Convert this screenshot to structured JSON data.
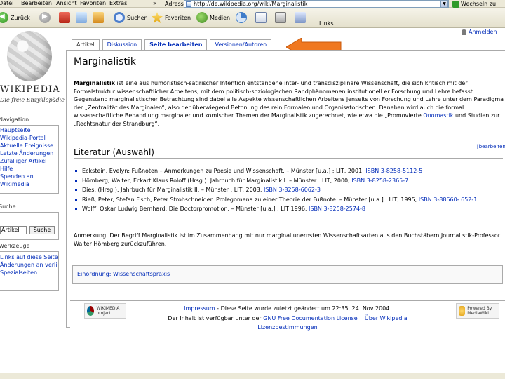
{
  "browser": {
    "menu": [
      "Datei",
      "Bearbeiten",
      "Ansicht",
      "Favoriten",
      "Extras"
    ],
    "menu_more": "»",
    "toolbar": {
      "back": "Zurück",
      "search": "Suchen",
      "favorites": "Favoriten",
      "media": "Medien"
    },
    "address_label": "Adresse",
    "address_url": "http://de.wikipedia.org/wiki/Marginalistik",
    "go_label": "Wechseln zu",
    "links_label": "Links"
  },
  "logo": {
    "wordmark": "WIKIPEDIA",
    "motto": "Die freie Enzyklopädie"
  },
  "sidebar": {
    "nav_heading": "Navigation",
    "nav_items": [
      "Hauptseite",
      "Wikipedia-Portal",
      "Aktuelle Ereignisse",
      "Letzte Änderungen",
      "Zufälliger Artikel",
      "Hilfe",
      "Spenden an",
      "Wikimedia"
    ],
    "search_heading": "Suche",
    "search_go": "Artikel",
    "search_button": "Suche",
    "tools_heading": "Werkzeuge",
    "tools_items": [
      "Links auf diese Seite",
      "Änderungen an verlinkten Seiten",
      "Spezialseiten"
    ]
  },
  "user": {
    "login": "Anmelden"
  },
  "tabs": [
    {
      "label": "Artikel"
    },
    {
      "label": "Diskussion"
    },
    {
      "label": "Seite bearbeiten"
    },
    {
      "label": "Versionen/Autoren"
    }
  ],
  "article": {
    "title": "Marginalistik",
    "intro_term": "Marginalistik",
    "intro_text": " ist eine aus humoristisch-satirischer Intention entstandene inter- und transdisziplinäre Wissenschaft, die sich kritisch mit der Formalstruktur wissenschaftlicher Arbeitens, mit dem politisch-soziologischen Randphänomenen institutionell er Forschung und Lehre befasst. Gegenstand marginalistischer Betrachtung sind dabei alle Aspekte wissenschaftlichen Arbeitens jenseits von Forschung und Lehre unter dem Paradigma der „Zentralität des Marginalen“, also der überwiegend Betonung des rein Formalen und Organisatorischen. Daneben wird auch die formal wissenschaftliche Behandlung marginaler und komischer Themen der Marginalistik zugerechnet, wie etwa die ",
    "intro_link": "Onomastik",
    "intro_tail": " und Studien zur „Rechtsnatur der Strandburg“.",
    "intro_lead": "„Promovierte ",
    "lit_heading": "Literatur (Auswahl)",
    "lit_edit": "[bearbeiten]",
    "literature": [
      {
        "text": "Eckstein, Evelyn: Fußnoten – Anmerkungen zu Poesie und Wissenschaft. – Münster [u.a.] : LIT, 2001.",
        "isbn": "ISBN 3-8258-5112-5"
      },
      {
        "text": "Hömberg, Walter, Eckart Klaus Roloff (Hrsg.): Jahrbuch für Marginalistik I. – Münster : LIT, 2000,",
        "isbn": "ISBN 3-8258-2365-7"
      },
      {
        "text": "Dies. (Hrsg.): Jahrbuch für Marginalistik II. – Münster : LIT, 2003,",
        "isbn": "ISBN 3-8258-6062-3"
      },
      {
        "text": "Rieß, Peter, Stefan Fisch, Peter Strohschneider: Prolegomena zu einer Theorie der Fußnote. – Münster [u.a.] : LIT, 1995,",
        "isbn": "ISBN 3-88660-"
      },
      {
        "text": "Wolff, Oskar Ludwig Bernhard: Die Doctorpromotion. – Münster [u.a.] : LIT 1996,",
        "isbn": "ISBN 3-8258-2574-8"
      }
    ],
    "isbn_cont": "652-1",
    "note": "Anmerkung: Der Begriff Marginalistik ist im Zusammenhang mit nur marginal unernsten Wissenschaftsarten aus den Buchstäbern Journal stik-Professor Walter Hömberg zurückzuführen.",
    "categories_label": "Einordnung:",
    "category": "Wissenschaftspraxis"
  },
  "footer": {
    "wikimedia_badge": "WIKIMEDIA project",
    "mediawiki_badge": "Powered By MediaWiki",
    "line1_link": "Impressum",
    "line1_text": " - Diese Seite wurde zuletzt geändert um 22:35, 24. Nov 2004.",
    "line2_text": "Der Inhalt ist verfügbar unter der ",
    "line2_link": "GNU Free Documentation License",
    "line2_link2": "Über Wikipedia",
    "line3_link": "Lizenzbestimmungen"
  },
  "colors": {
    "link": "#002bb8",
    "arrow": "#f07820",
    "chrome": "#ece9d8"
  }
}
